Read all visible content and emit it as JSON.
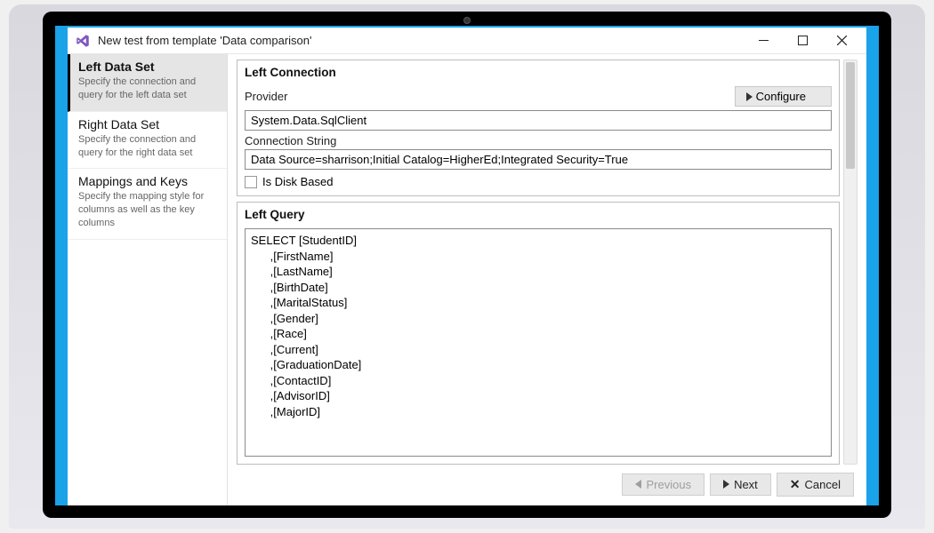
{
  "window": {
    "title": "New test from template 'Data comparison'"
  },
  "sidebar": {
    "steps": [
      {
        "title": "Left Data Set",
        "desc": "Specify the connection and query for the left data set",
        "active": true
      },
      {
        "title": "Right Data Set",
        "desc": "Specify the connection and query for the right data set",
        "active": false
      },
      {
        "title": "Mappings and Keys",
        "desc": "Specify the mapping style for columns as well as the key columns",
        "active": false
      }
    ]
  },
  "connection": {
    "groupTitle": "Left Connection",
    "providerLabel": "Provider",
    "configureLabel": "Configure",
    "providerValue": "System.Data.SqlClient",
    "connStrLabel": "Connection String",
    "connStrValue": "Data Source=sharrison;Initial Catalog=HigherEd;Integrated Security=True",
    "diskBasedLabel": "Is Disk Based"
  },
  "query": {
    "groupTitle": "Left Query",
    "text": "SELECT [StudentID]\n      ,[FirstName]\n      ,[LastName]\n      ,[BirthDate]\n      ,[MaritalStatus]\n      ,[Gender]\n      ,[Race]\n      ,[Current]\n      ,[GraduationDate]\n      ,[ContactID]\n      ,[AdvisorID]\n      ,[MajorID]"
  },
  "footer": {
    "previous": "Previous",
    "next": "Next",
    "cancel": "Cancel"
  }
}
